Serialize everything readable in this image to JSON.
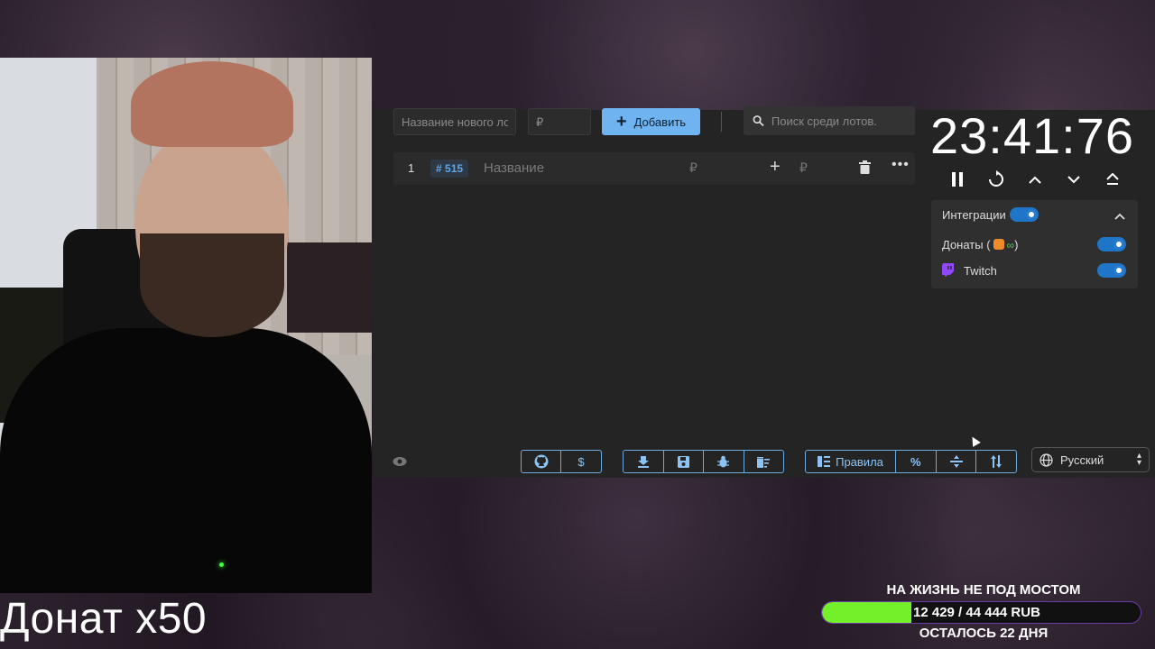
{
  "overlay": {
    "donate_multiplier": "Донат x50"
  },
  "toolbar": {
    "new_lot_placeholder": "Название нового лота",
    "price_placeholder": "₽",
    "add_button": "Добавить",
    "search_placeholder": "Поиск среди лотов."
  },
  "lots": [
    {
      "index": "1",
      "id": "515",
      "name_placeholder": "Название",
      "currency": "₽",
      "add_currency": "₽"
    }
  ],
  "timer": {
    "display": "23:41:76"
  },
  "integrations": {
    "title": "Интеграции",
    "enabled": true,
    "items": [
      {
        "label": "Донаты (",
        "suffix": ")",
        "enabled": true
      },
      {
        "label": "Twitch",
        "enabled": true
      }
    ]
  },
  "footer": {
    "rules_button": "Правила",
    "percent_button": "%",
    "language": "Русский"
  },
  "goal": {
    "title": "НА ЖИЗНЬ НЕ ПОД МОСТОМ",
    "amount": "12 429 / 44 444 RUB",
    "remaining": "ОСТАЛОСЬ 22 ДНЯ",
    "progress": 0.28
  },
  "colors": {
    "accent": "#6fb3f0",
    "toggle": "#1f76c9",
    "goal_fill": "#74f02a"
  }
}
